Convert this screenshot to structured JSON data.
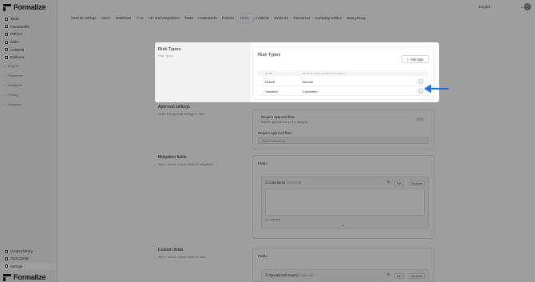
{
  "app": {
    "brand": "Formalize"
  },
  "sidebar": {
    "items": [
      {
        "label": "Tasks",
        "icon": "tasks-icon"
      },
      {
        "label": "Frameworks",
        "icon": "frameworks-icon"
      },
      {
        "label": "Policies",
        "icon": "policies-icon"
      },
      {
        "label": "Risks",
        "icon": "risks-icon"
      },
      {
        "label": "Incidents",
        "icon": "incidents-icon"
      },
      {
        "label": "Evidence",
        "icon": "evidence-icon"
      }
    ],
    "groups": [
      "Insights",
      "Resources",
      "Workflows",
      "Privacy",
      "Guidance"
    ],
    "bottom_items": [
      {
        "label": "Content library",
        "icon": "library-icon"
      },
      {
        "label": "Trust Center",
        "icon": "trust-center-icon"
      },
      {
        "label": "Settings",
        "icon": "settings-icon"
      }
    ]
  },
  "topbar": {
    "tabs": [
      "General settings",
      "Users",
      "Workflows",
      "AI",
      "API and integrations",
      "Tasks",
      "Frameworks",
      "Policies",
      "Risks",
      "Incidents",
      "Evidence",
      "Resources",
      "Company entities",
      "Data privacy"
    ],
    "active_tab": "Risks",
    "language": "English",
    "avatar_initials": "JH"
  },
  "modal": {
    "left_title": "Risk Types",
    "left_subtitle": "Risk Types",
    "card_title": "Risk Types",
    "add_button": "Add type",
    "columns": [
      "NAME",
      "DEFAULT MITIGATION STRATEGY"
    ],
    "rows": [
      {
        "name": "Default",
        "strategy": "Manual"
      },
      {
        "name": "Standard",
        "strategy": "Calculated"
      }
    ]
  },
  "background": {
    "approval": {
      "title": "Approval settings",
      "desc": "Define the approval settings for risks.",
      "flow_label": "Require approval flow",
      "flow_desc": "Require approval flow for this category.",
      "select_label": "Require approval flow",
      "select_placeholder": "Select something"
    },
    "mitigation": {
      "title": "Mitigation fields",
      "desc": "Add or remove custom fields for mitigations.",
      "fields_label": "Fields",
      "field_name": "Comments",
      "field_optional": "(Optional)",
      "edit": "Edit",
      "duplicate": "Duplicate",
      "type": "Large text"
    },
    "custom": {
      "title": "Custom fields",
      "desc": "Add or remove custom fields for risks.",
      "fields_label": "Fields",
      "field_name": "Operational Impact",
      "field_optional": "(Optional)",
      "edit": "Edit",
      "duplicate": "Duplicate"
    }
  },
  "colors": {
    "accent": "#1a6fd8",
    "arrow": "#1e73e0"
  }
}
